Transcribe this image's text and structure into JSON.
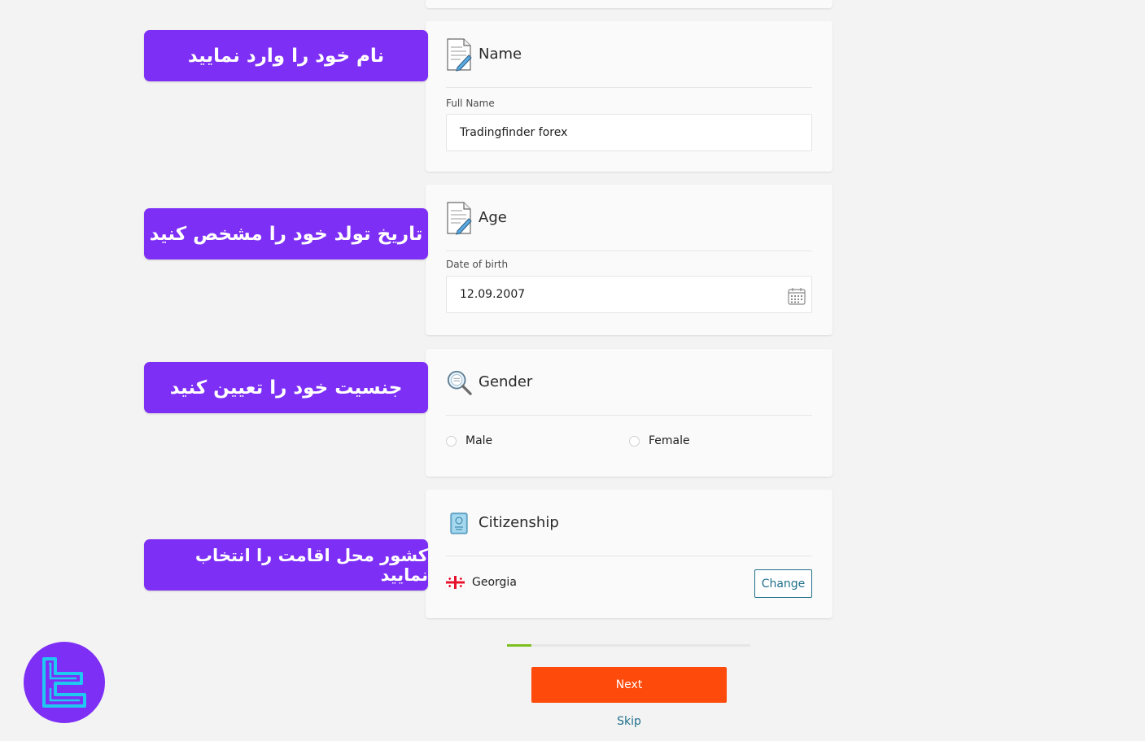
{
  "colors": {
    "banner": "#7d2ff5",
    "primary_button": "#fe4a0b",
    "link": "#1f6f8b",
    "progress": "#7cc020",
    "logo_stroke": "#1ec8f0"
  },
  "banners": [
    {
      "text": "نام خود را  وارد نمایید"
    },
    {
      "text": "تاریخ تولد خود را مشخص کنید"
    },
    {
      "text": "جنسیت خود را تعیین کنید"
    },
    {
      "text": "کشور محل اقامت را انتخاب نمایید"
    }
  ],
  "name_card": {
    "title": "Name",
    "icon": "document-pencil-icon",
    "field_label": "Full Name",
    "value": "Tradingfinder forex"
  },
  "age_card": {
    "title": "Age",
    "icon": "document-pencil-icon",
    "field_label": "Date of birth",
    "value": "12.09.2007",
    "trailing_icon": "calendar-icon"
  },
  "gender_card": {
    "title": "Gender",
    "icon": "magnifier-icon",
    "options": [
      "Male",
      "Female"
    ],
    "selected": null
  },
  "citizenship_card": {
    "title": "Citizenship",
    "icon": "passport-icon",
    "country": "Georgia",
    "flag_icon": "georgia-flag-icon",
    "change_label": "Change"
  },
  "progress": {
    "fraction": 0.1
  },
  "actions": {
    "next_label": "Next",
    "skip_label": "Skip"
  },
  "logo": {
    "icon": "tradingfinder-logo"
  }
}
